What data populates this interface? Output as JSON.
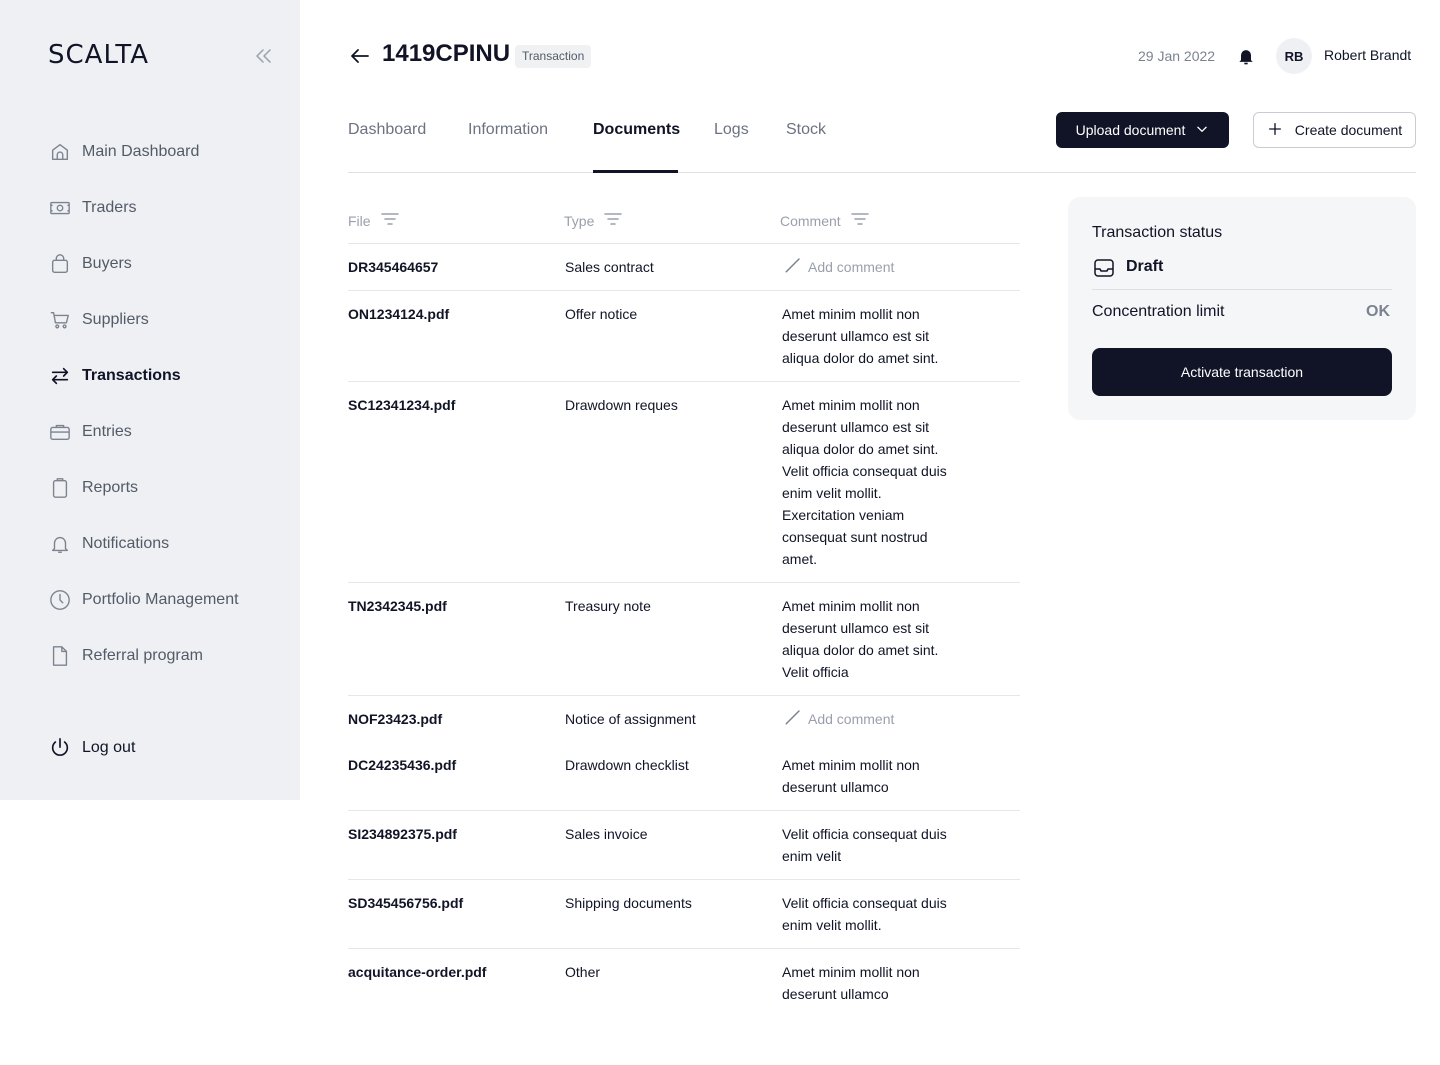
{
  "sidebar": {
    "logo": "SCALTA",
    "items": [
      {
        "label": "Main Dashboard",
        "icon": "home-icon"
      },
      {
        "label": "Traders",
        "icon": "money-icon"
      },
      {
        "label": "Buyers",
        "icon": "bag-icon"
      },
      {
        "label": "Suppliers",
        "icon": "cart-icon"
      },
      {
        "label": "Transactions",
        "icon": "swap-icon",
        "active": true
      },
      {
        "label": "Entries",
        "icon": "briefcase-icon"
      },
      {
        "label": "Reports",
        "icon": "clipboard-icon"
      },
      {
        "label": "Notifications",
        "icon": "bell-icon"
      },
      {
        "label": "Portfolio Management",
        "icon": "clock-icon"
      },
      {
        "label": "Referral program",
        "icon": "document-icon"
      }
    ],
    "logout": "Log out"
  },
  "header": {
    "transaction_id": "1419CPINU",
    "badge": "Transaction",
    "date": "29 Jan 2022",
    "user_initials": "RB",
    "user_name": "Robert Brandt"
  },
  "tabs": [
    {
      "label": "Dashboard"
    },
    {
      "label": "Information"
    },
    {
      "label": "Documents",
      "active": true
    },
    {
      "label": "Logs"
    },
    {
      "label": "Stock"
    }
  ],
  "actions": {
    "upload": "Upload document",
    "create": "Create document"
  },
  "table": {
    "columns": [
      "File",
      "Type",
      "Comment"
    ],
    "add_comment": "Add comment",
    "rows": [
      {
        "file": "DR345464657",
        "type": "Sales contract",
        "comment": ""
      },
      {
        "file": "ON1234124.pdf",
        "type": "Offer notice",
        "comment": "Amet minim mollit non deserunt ullamco est sit aliqua dolor do amet sint."
      },
      {
        "file": "SC12341234.pdf",
        "type": "Drawdown reques",
        "comment": "Amet minim mollit non deserunt ullamco est sit aliqua dolor do amet sint. Velit officia consequat duis enim velit mollit. Exercitation veniam consequat sunt nostrud amet."
      },
      {
        "file": "TN2342345.pdf",
        "type": "Treasury note",
        "comment": "Amet minim mollit non deserunt ullamco est sit aliqua dolor do amet sint. Velit officia"
      },
      {
        "file": "NOF23423.pdf",
        "type": "Notice of assignment",
        "comment": ""
      },
      {
        "file": "DC24235436.pdf",
        "type": "Drawdown checklist",
        "comment": "Amet minim mollit non deserunt ullamco"
      },
      {
        "file": "SI234892375.pdf",
        "type": "Sales invoice",
        "comment": "Velit officia consequat duis enim velit"
      },
      {
        "file": "SD345456756.pdf",
        "type": "Shipping documents",
        "comment": "Velit officia consequat duis enim velit mollit."
      },
      {
        "file": "acquitance-order.pdf",
        "type": "Other",
        "comment": "Amet minim mollit non deserunt ullamco"
      }
    ]
  },
  "status_card": {
    "title": "Transaction status",
    "status": "Draft",
    "concentration_label": "Concentration limit",
    "concentration_value": "OK",
    "activate_label": "Activate transaction"
  }
}
